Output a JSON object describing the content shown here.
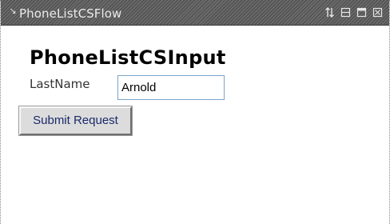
{
  "portlet": {
    "title": "PhoneListCSFlow",
    "collapse_glyph": "↘",
    "controls": [
      {
        "name": "move-icon"
      },
      {
        "name": "minimize-icon"
      },
      {
        "name": "maximize-icon"
      },
      {
        "name": "close-icon"
      }
    ]
  },
  "form": {
    "heading": "PhoneListCSInput",
    "lastname_label": "LastName",
    "lastname_value": "Arnold",
    "submit_label": "Submit Request"
  },
  "colors": {
    "titlebar": "#5c5c5c",
    "input_border": "#7ea3c8",
    "button_text": "#1a2a6b"
  }
}
